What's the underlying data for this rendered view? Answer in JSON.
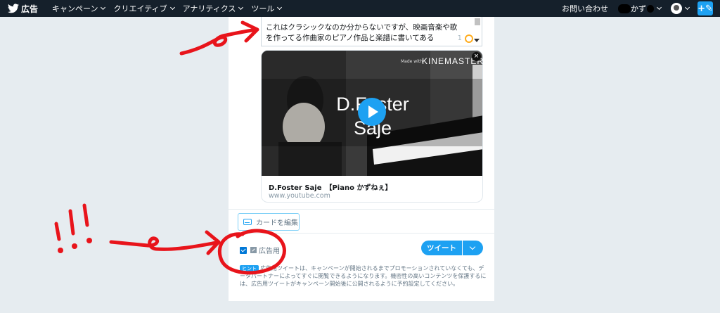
{
  "nav": {
    "brand_label": "広告",
    "items": [
      {
        "label": "キャンペーン",
        "name": "nav-item-campaigns"
      },
      {
        "label": "クリエイティブ",
        "name": "nav-item-creatives"
      },
      {
        "label": "アナリティクス",
        "name": "nav-item-analytics"
      },
      {
        "label": "ツール",
        "name": "nav-item-tools"
      }
    ],
    "contact_label": "お問い合わせ",
    "account_label": "かず",
    "compose_icon": "compose-tweet-icon"
  },
  "composer": {
    "tweet_text_line1": "これはクラシックなのか分からないですが、映画音楽や歌",
    "tweet_text_line2": "を作ってる作曲家のピアノ作品と楽譜に書いてある",
    "char_count": "1",
    "card": {
      "video_title_line1": "D.Foster",
      "video_title_line2": "Saje",
      "made_with": "Made with",
      "kinemaster": "KINEMASTER",
      "close_symbol": "×",
      "title": "D.Foster Saje　【Piano かずねぇ】",
      "domain": "www.youtube.com"
    },
    "edit_card_label": "カードを編集",
    "promoted_only_label": "広告用",
    "tweet_button_label": "ツイート",
    "hint_badge": "ヒント",
    "hint_text": "広告用ツイートは、キャンペーンが開始されるまでプロモーションされていなくても、データパートナーによってすぐに閲覧できるようになります。機密性の高いコンテンツを保護するには、広告用ツイートがキャンペーン開始後に公開されるように予約設定してください。"
  },
  "annotations": {
    "exclamation_text": "!!!",
    "color": "#e8141b"
  },
  "colors": {
    "topbar": "#15202b",
    "accent": "#1da1f2",
    "background": "#e6ecf0"
  }
}
